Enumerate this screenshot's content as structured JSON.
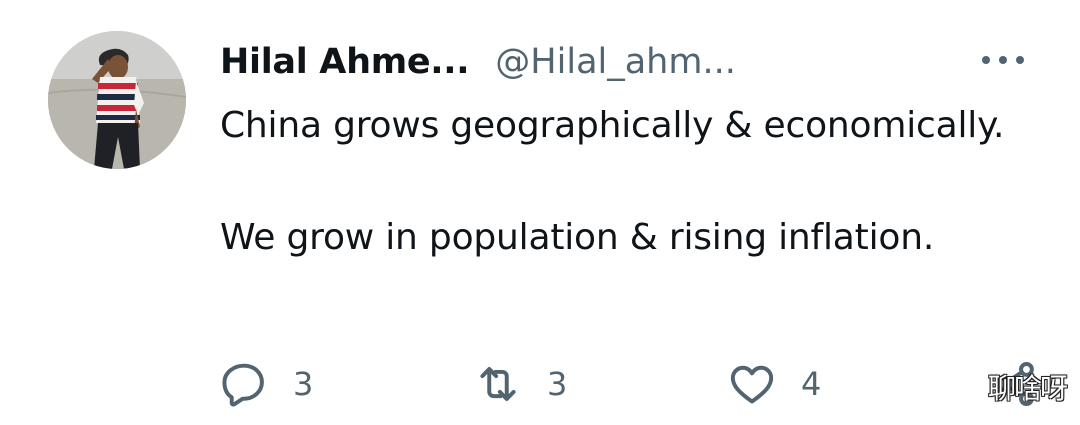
{
  "author": {
    "display_name": "Hilal Ahme...",
    "handle": "@Hilal_ahm..."
  },
  "tweet": {
    "paragraphs": [
      "China grows geographically & economically.",
      "We grow in population & rising inflation."
    ]
  },
  "actions": {
    "reply": {
      "icon": "reply-icon",
      "count": "3"
    },
    "retweet": {
      "icon": "retweet-icon",
      "count": "3"
    },
    "like": {
      "icon": "heart-icon",
      "count": "4"
    },
    "share": {
      "icon": "share-icon"
    }
  },
  "menu": {
    "icon": "more-icon"
  },
  "watermark": {
    "text": "聊啥呀"
  },
  "colors": {
    "text": "#0f1419",
    "secondary": "#536471",
    "background": "#ffffff"
  }
}
